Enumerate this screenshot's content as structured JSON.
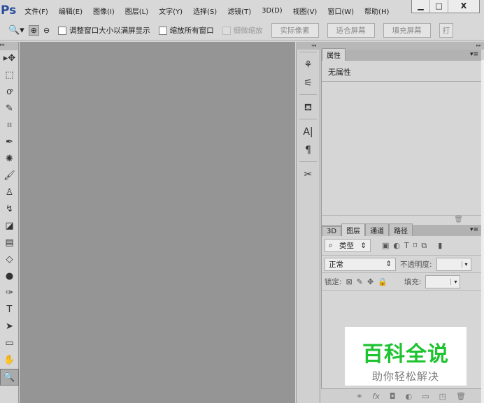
{
  "app": {
    "logo": "Ps"
  },
  "menu": [
    "文件(F)",
    "编辑(E)",
    "图像(I)",
    "图层(L)",
    "文字(Y)",
    "选择(S)",
    "滤镜(T)",
    "3D(D)",
    "视图(V)",
    "窗口(W)",
    "帮助(H)"
  ],
  "window_controls": {
    "minimize": "▁",
    "maximize": "□",
    "close": "X"
  },
  "options": {
    "resize_windows": "调整窗口大小以满屏显示",
    "zoom_all": "缩放所有窗口",
    "scrubby_zoom": "细微缩放",
    "actual_pixels": "实际像素",
    "fit_screen": "适合屏幕",
    "fill_screen": "填充屏幕",
    "print_size": "打"
  },
  "properties": {
    "tab": "属性",
    "content": "无属性"
  },
  "layers": {
    "tabs": [
      "3D",
      "图层",
      "通道",
      "路径"
    ],
    "filter_kind": "类型",
    "blend_mode": "正常",
    "opacity_label": "不透明度:",
    "lock_label": "锁定:",
    "fill_label": "填充:"
  },
  "watermark": {
    "title": "百科全说",
    "subtitle": "助你轻松解决"
  },
  "tools": [
    [
      "move-tool",
      "▸✥"
    ],
    [
      "marquee-tool",
      "⬚"
    ],
    [
      "lasso-tool",
      "ꝍ"
    ],
    [
      "quick-select-tool",
      "✎"
    ],
    [
      "crop-tool",
      "⌗"
    ],
    [
      "eyedropper-tool",
      "✒"
    ],
    [
      "healing-tool",
      "✺"
    ],
    [
      "brush-tool",
      "🖌"
    ],
    [
      "stamp-tool",
      "♙"
    ],
    [
      "history-brush-tool",
      "↯"
    ],
    [
      "eraser-tool",
      "◪"
    ],
    [
      "gradient-tool",
      "▤"
    ],
    [
      "blur-tool",
      "◇"
    ],
    [
      "dodge-tool",
      "●"
    ],
    [
      "pen-tool",
      "✑"
    ],
    [
      "type-tool",
      "T"
    ],
    [
      "path-select-tool",
      "➤"
    ],
    [
      "rectangle-tool",
      "▭"
    ],
    [
      "hand-tool",
      "✋"
    ],
    [
      "zoom-tool",
      "🔍"
    ]
  ]
}
